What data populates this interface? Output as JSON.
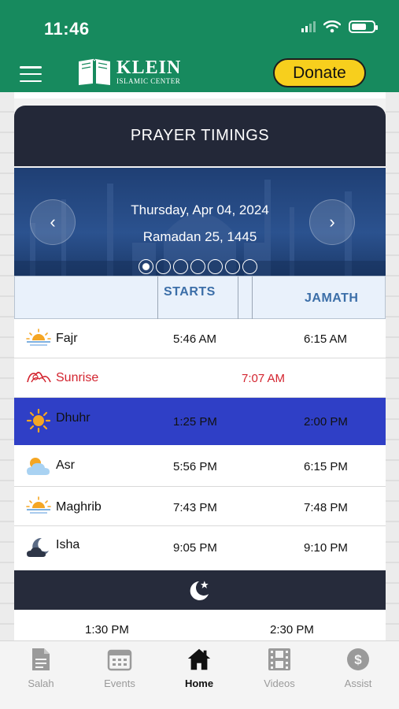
{
  "status_bar": {
    "time": "11:46"
  },
  "header": {
    "logo_name": "KLEIN",
    "logo_sub": "ISLAMIC CENTER",
    "donate_label": "Donate",
    "colors": {
      "header_bg": "#178a5e",
      "donate_bg": "#f7cf1d"
    }
  },
  "prayer_card": {
    "title": "PRAYER TIMINGS",
    "date": "Thursday, Apr 04, 2024",
    "hijri": "Ramadan 25, 1445",
    "prev_icon": "chevron-left-icon",
    "next_icon": "chevron-right-icon",
    "page_dots": {
      "count": 7,
      "active": 1
    },
    "columns": {
      "starts": "STARTS",
      "jamath": "JAMATH"
    },
    "rows": [
      {
        "name": "Fajr",
        "icon": "sun-horizon-icon",
        "starts": "5:46 AM",
        "jamath": "6:15 AM"
      },
      {
        "name": "Sunrise",
        "icon": "sunrise-icon",
        "starts": "7:07 AM"
      },
      {
        "name": "Dhuhr",
        "icon": "sun-icon",
        "starts": "1:25 PM",
        "jamath": "2:00 PM",
        "highlight": true
      },
      {
        "name": "Asr",
        "icon": "cloud-sun-icon",
        "starts": "5:56 PM",
        "jamath": "6:15 PM"
      },
      {
        "name": "Maghrib",
        "icon": "sunset-icon",
        "starts": "7:43 PM",
        "jamath": "7:48 PM"
      },
      {
        "name": "Isha",
        "icon": "moon-cloud-icon",
        "starts": "9:05 PM",
        "jamath": "9:10 PM"
      }
    ],
    "jumuah_icon": "crescent-star-icon",
    "jumuah_times": [
      "1:30 PM",
      "2:30 PM"
    ],
    "colors": {
      "highlight_row": "#2f3fc6",
      "sunrise_text": "#d3242f",
      "column_header_text": "#3b6ea8"
    }
  },
  "tabbar": {
    "tabs": [
      {
        "label": "Salah",
        "icon": "document-icon",
        "active": false
      },
      {
        "label": "Events",
        "icon": "calendar-icon",
        "active": false
      },
      {
        "label": "Home",
        "icon": "home-icon",
        "active": true
      },
      {
        "label": "Videos",
        "icon": "film-icon",
        "active": false
      },
      {
        "label": "Assist",
        "icon": "dollar-icon",
        "active": false
      }
    ]
  }
}
